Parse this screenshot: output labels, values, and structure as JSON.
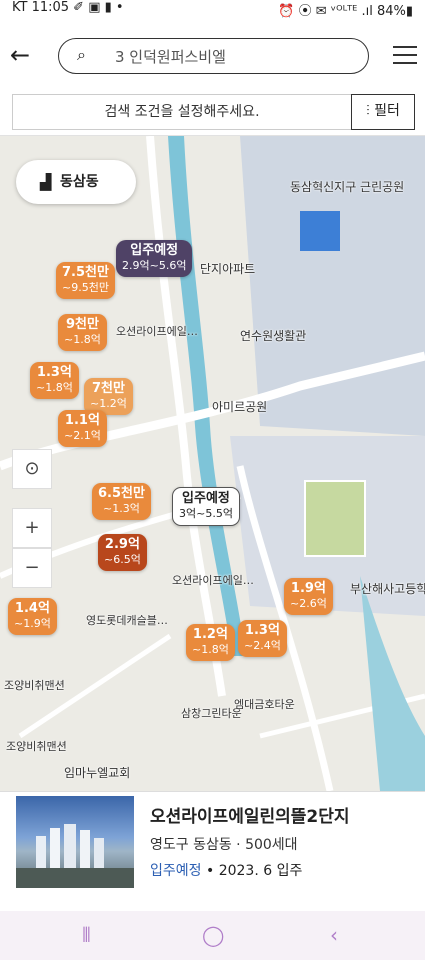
{
  "status_bar": {
    "left": "KT 11:05 ✐ ▣ ▮ •",
    "right": "⏰ ⦿ ✉ ᵛᴼᴸᵀᴱ .ıl 84%▮"
  },
  "search": {
    "back_icon": "back-arrow-icon",
    "query": "3 인덕원퍼스비엘",
    "menu_icon": "hamburger-icon"
  },
  "filter": {
    "condition_text": "검색 조건을 설정해주세요.",
    "button_label": "필터"
  },
  "map": {
    "region_button": "동삼동",
    "labels": [
      "동삼혁신지구 근린공원",
      "연수원생활관",
      "아미르공원",
      "부산해사고등학교",
      "영도롯데캐슬블…",
      "조양비취맨션",
      "삼창그린타운",
      "엠대금호타운",
      "오션라이프에일…",
      "오션라이프에일…",
      "임마누엘교회",
      "단지아파트",
      "조양비취맨션"
    ],
    "pins": [
      {
        "a": "입주예정",
        "b": "2.9억~5.6억"
      },
      {
        "a": "7.5천만",
        "b": "~9.5천만"
      },
      {
        "a": "9천만",
        "b": "~1.8억"
      },
      {
        "a": "1.3억",
        "b": "~1.8억"
      },
      {
        "a": "7천만",
        "b": "~1.2억"
      },
      {
        "a": "1.1억",
        "b": "~2.1억"
      },
      {
        "a": "6.5천만",
        "b": "~1.3억"
      },
      {
        "a": "입주예정",
        "b": "3억~5.5억"
      },
      {
        "a": "2.9억",
        "b": "~6.5억"
      },
      {
        "a": "1.4억",
        "b": "~1.9억"
      },
      {
        "a": "1.2억",
        "b": "~1.8억"
      },
      {
        "a": "1.3억",
        "b": "~2.4억"
      },
      {
        "a": "1.9억",
        "b": "~2.6억"
      }
    ]
  },
  "card": {
    "title": "오션라이프에일린의뜰2단지",
    "sub": "영도구 동삼동 · 500세대",
    "status": "입주예정",
    "date": "• 2023. 6 입주"
  }
}
